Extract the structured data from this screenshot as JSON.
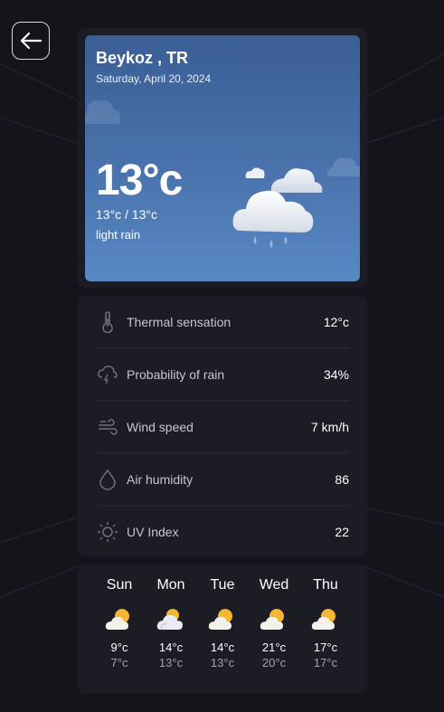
{
  "location": {
    "city": "Beykoz , TR",
    "date": "Saturday, April 20, 2024"
  },
  "current": {
    "temperature": "13°c",
    "minmax": "13°c / 13°c",
    "description": "light rain",
    "icon": "rain-cloud-icon"
  },
  "details": [
    {
      "label": "Thermal sensation",
      "value": "12°c",
      "icon": "thermometer-icon"
    },
    {
      "label": "Probability of rain",
      "value": "34%",
      "icon": "cloud-rain-icon"
    },
    {
      "label": "Wind speed",
      "value": "7 km/h",
      "icon": "wind-icon"
    },
    {
      "label": "Air humidity",
      "value": "86",
      "icon": "drop-icon"
    },
    {
      "label": "UV Index",
      "value": "22",
      "icon": "sun-icon"
    }
  ],
  "forecast": [
    {
      "day": "Sun",
      "max": "9°c",
      "min": "7°c",
      "icon": "partly-sunny-icon"
    },
    {
      "day": "Mon",
      "max": "14°c",
      "min": "13°c",
      "icon": "partly-cloudy-icon"
    },
    {
      "day": "Tue",
      "max": "14°c",
      "min": "13°c",
      "icon": "partly-sunny-icon"
    },
    {
      "day": "Wed",
      "max": "21°c",
      "min": "20°c",
      "icon": "partly-sunny-icon"
    },
    {
      "day": "Thu",
      "max": "17°c",
      "min": "17°c",
      "icon": "partly-sunny-icon"
    }
  ],
  "colors": {
    "background": "#15141b",
    "panel": "#1c1c25",
    "hero_top": "#3a5e95",
    "hero_bottom": "#5888c2"
  }
}
